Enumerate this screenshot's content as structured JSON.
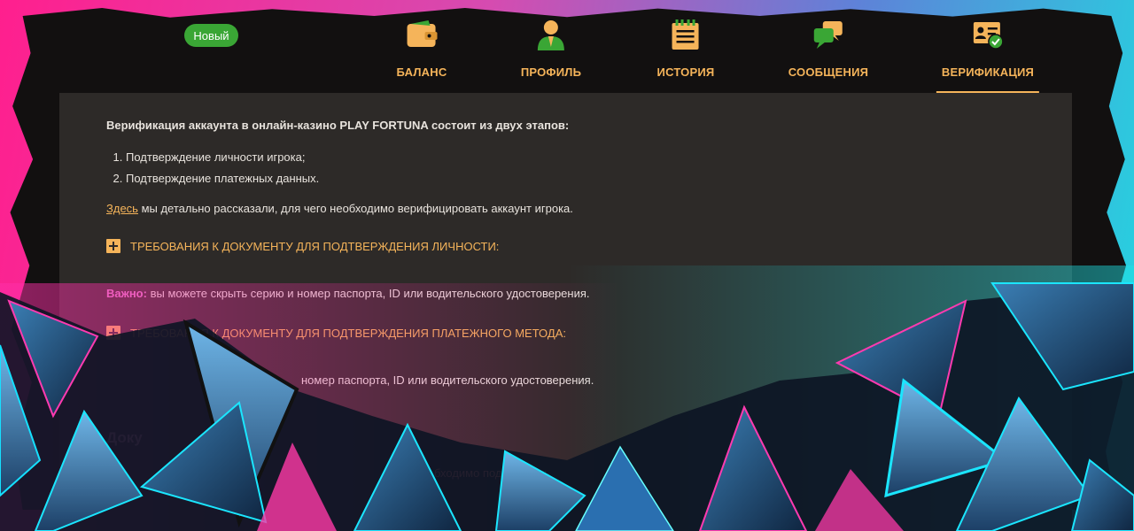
{
  "header": {
    "badge_new": "Новый"
  },
  "nav": {
    "items": [
      {
        "label": "БАЛАНС",
        "icon": "wallet-icon"
      },
      {
        "label": "ПРОФИЛЬ",
        "icon": "user-icon"
      },
      {
        "label": "ИСТОРИЯ",
        "icon": "notepad-icon"
      },
      {
        "label": "СООБЩЕНИЯ",
        "icon": "chat-icon"
      },
      {
        "label": "ВЕРИФИКАЦИЯ",
        "icon": "id-card-check-icon",
        "active": true
      }
    ]
  },
  "content": {
    "intro": "Верификация аккаунта в онлайн-казино PLAY FORTUNA состоит из двух этапов:",
    "steps": [
      "Подтверждение личности игрока;",
      "Подтверждение платежных данных."
    ],
    "here_link": "Здесь",
    "here_text": " мы детально рассказали, для чего необходимо верифицировать аккаунт игрока.",
    "req1": "ТРЕБОВАНИЯ К ДОКУМЕНТУ ДЛЯ ПОДТВЕРЖДЕНИЯ ЛИЧНОСТИ:",
    "important_label": "Важно:",
    "important_text": " вы можете скрыть серию и номер паспорта, ID или водительского удостоверения.",
    "req2": "ТРЕБОВАНИЯ К ДОКУМЕНТУ ДЛЯ ПОДТВЕРЖДЕНИЯ ПЛАТЕЖНОГО МЕТОДА:",
    "important2_text": "номер паспорта, ID или водительского удостоверения.",
    "faded_title": "Доку",
    "faded_text": "бходимо подтвердить"
  },
  "colors": {
    "accent": "#f5b45a",
    "badge": "#3aa635",
    "panel": "#2d2a28",
    "frame": "#121010",
    "pink": "#ff1f8e",
    "cyan": "#21d9e0"
  }
}
